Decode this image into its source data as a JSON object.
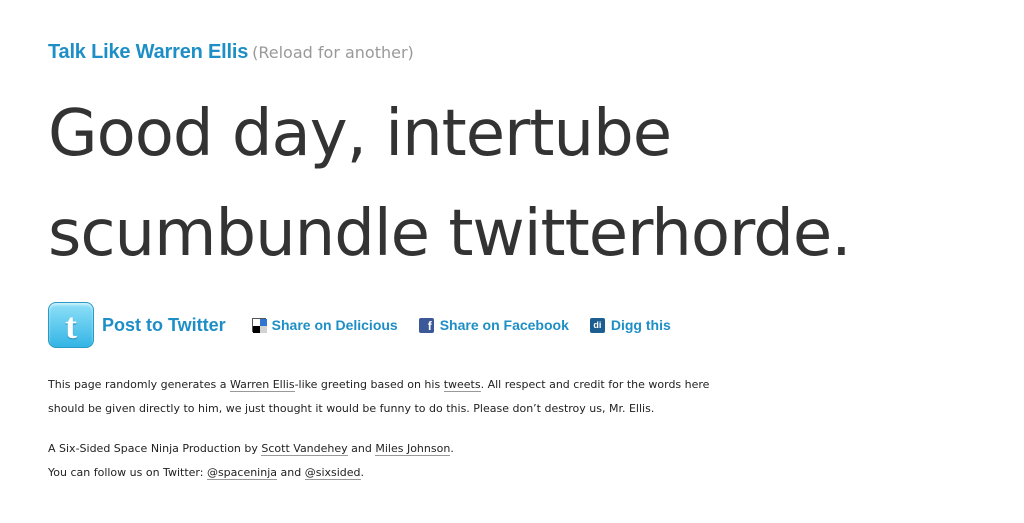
{
  "header": {
    "title": "Talk Like Warren Ellis",
    "reload": "(Reload for another)"
  },
  "greeting": {
    "line1": "Good day, intertube",
    "line2": "scumbundle twitterhorde."
  },
  "share": {
    "twitter": {
      "label": "Post to Twitter",
      "icon": "twitter-icon"
    },
    "delicious": {
      "label": "Share on Delicious",
      "icon": "delicious-icon"
    },
    "facebook": {
      "label": "Share on Facebook",
      "icon": "facebook-icon"
    },
    "digg": {
      "label": "Digg this",
      "icon": "digg-icon"
    }
  },
  "about": {
    "t1": "This page randomly generates a ",
    "link_warren": "Warren Ellis",
    "t2": "-like greeting based on his ",
    "link_tweets": "tweets",
    "t3": ". All respect and credit for the words here should be given directly to him, we just thought it would be funny to do this. Please don’t destroy us, Mr. Ellis."
  },
  "credits": {
    "t1": "A Six-Sided Space Ninja Production by ",
    "link_scott": "Scott Vandehey",
    "t2": " and ",
    "link_miles": "Miles Johnson",
    "t3": ".",
    "t4": "You can follow us on Twitter: ",
    "link_spaceninja": "@spaceninja",
    "t5": " and ",
    "link_sixsided": "@sixsided",
    "t6": "."
  },
  "colors": {
    "link_blue": "#1e8fc6",
    "text": "#333333",
    "muted": "#999999",
    "facebook": "#3b5998",
    "digg": "#1d5e91"
  }
}
